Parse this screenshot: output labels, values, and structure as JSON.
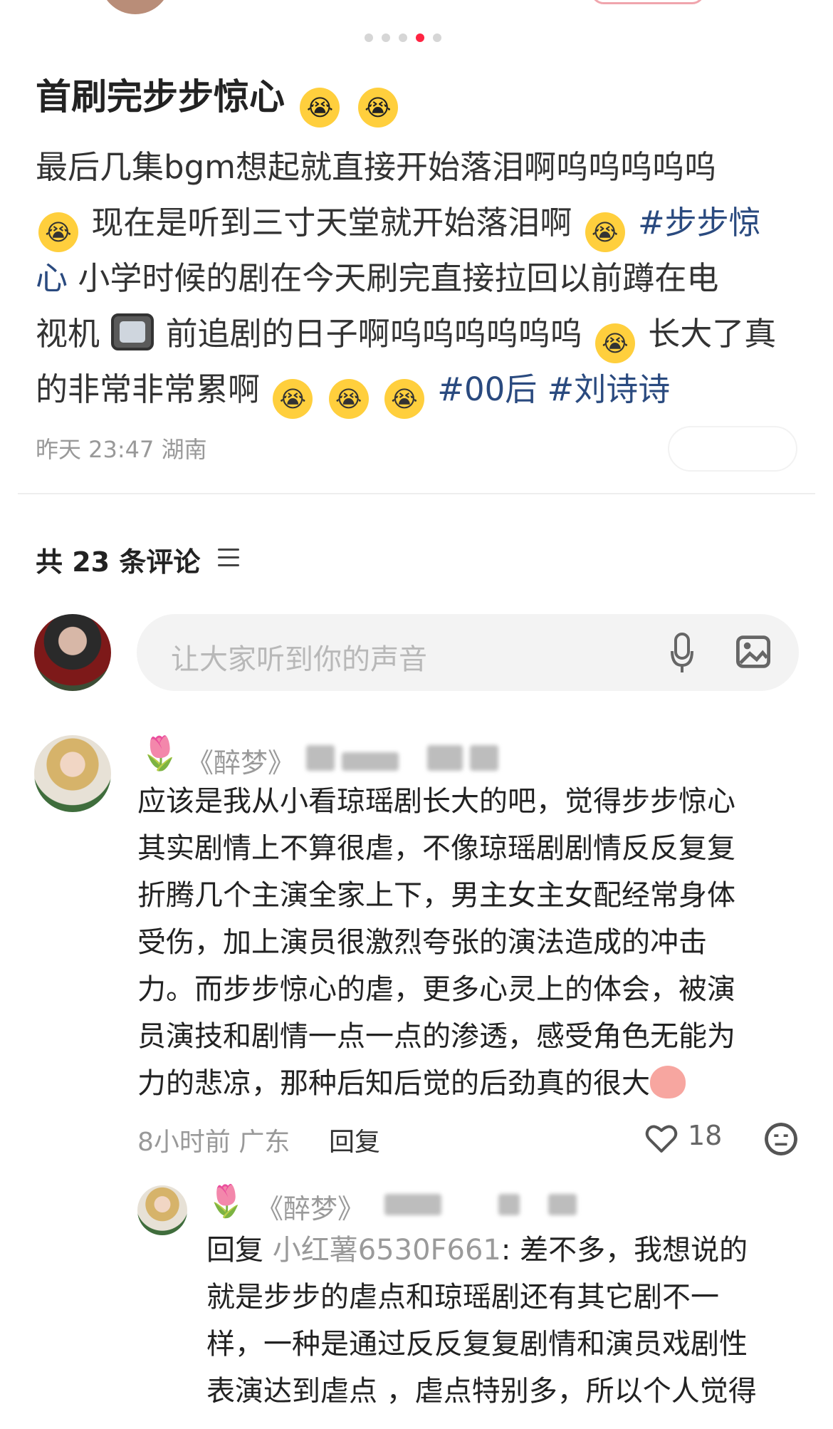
{
  "pager": {
    "count": 5,
    "active": 3
  },
  "post": {
    "title": "首刷完步步惊心",
    "lines": [
      {
        "pre": "最后几集bgm想起就直接开始落泪啊呜呜呜呜呜"
      },
      {
        "pre": "现在是听到三寸天堂就开始落泪啊",
        "tag": "#步步惊"
      },
      {
        "tag": "心",
        "post": " 小学时候的剧在今天刷完直接拉回以前蹲在电"
      },
      {
        "pre": "视机",
        "mid": "前追剧的日子啊呜呜呜呜呜呜",
        "post": " 长大了真"
      },
      {
        "pre": "的非常非常累啊",
        "tag1": "#00后",
        "tag2": "#刘诗诗"
      }
    ],
    "meta": "昨天 23:47 湖南"
  },
  "comments_header": {
    "label": "共 23 条评论"
  },
  "input": {
    "placeholder": "让大家听到你的声音"
  },
  "comment": {
    "flower": "🌷",
    "name": "《醉梦》",
    "lines": [
      "应该是我从小看琼瑶剧长大的吧，觉得步步惊心",
      "其实剧情上不算很虐，不像琼瑶剧剧情反反复复",
      "折腾几个主演全家上下，男主女主女配经常身体",
      "受伤，加上演员很激烈夸张的演法造成的冲击",
      "力。而步步惊心的虐，更多心灵上的体会，被演",
      "员演技和剧情一点一点的渗透，感受角色无能为",
      "力的悲凉，那种后知后觉的后劲真的很大"
    ],
    "meta": "8小时前 广东",
    "reply_label": "回复",
    "likes": "18"
  },
  "reply": {
    "flower": "🌷",
    "name": "《醉梦》",
    "prefix": "回复 ",
    "quoted_user": "小红薯6530F661",
    "first_text": ": 差不多，我想说的",
    "lines": [
      "就是步步的虐点和琼瑶剧还有其它剧不一",
      "样，一种是通过反反复复剧情和演员戏剧性",
      "表演达到虐点 ，虐点特别多，所以个人觉得"
    ]
  },
  "colors": {
    "accent": "#ff2442",
    "tag": "#2a4a7f"
  },
  "icons": [
    "crying-emoji-icon",
    "tv-emoji-icon",
    "filter-icon",
    "microphone-icon",
    "image-icon",
    "heart-icon",
    "emoji-face-icon",
    "tulip-icon"
  ]
}
